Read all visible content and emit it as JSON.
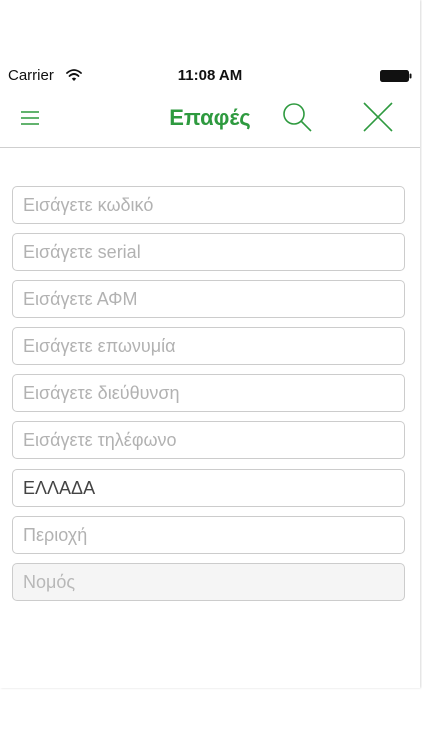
{
  "status_bar": {
    "carrier": "Carrier",
    "time": "11:08 AM"
  },
  "nav": {
    "title": "Επαφές",
    "accent_color": "#2e9a3f",
    "icons": [
      "hamburger-menu-icon",
      "search-icon",
      "close-icon"
    ]
  },
  "form": {
    "code": {
      "value": "",
      "placeholder": "Εισάγετε κωδικό"
    },
    "serial": {
      "value": "",
      "placeholder": "Εισάγετε serial"
    },
    "afm": {
      "value": "",
      "placeholder": "Εισάγετε ΑΦΜ"
    },
    "company_name": {
      "value": "",
      "placeholder": "Εισάγετε επωνυμία"
    },
    "address": {
      "value": "",
      "placeholder": "Εισάγετε διεύθυνση"
    },
    "phone": {
      "value": "",
      "placeholder": "Εισάγετε τηλέφωνο"
    },
    "country": {
      "value": "ΕΛΛΑΔΑ",
      "placeholder": ""
    },
    "region": {
      "value": "",
      "placeholder": "Περιοχή"
    },
    "prefecture": {
      "value": "",
      "placeholder": "Νομός"
    }
  }
}
